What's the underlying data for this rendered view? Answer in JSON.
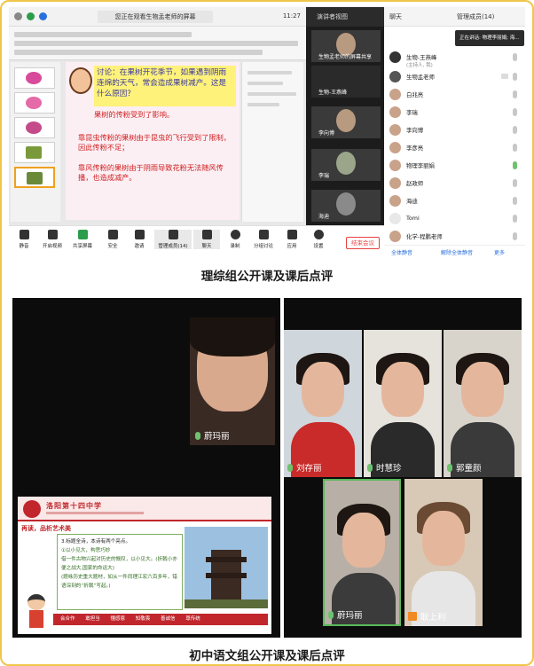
{
  "top": {
    "window_title": "您正在观看生物孟老师的屏幕",
    "time": "11:27",
    "slide": {
      "question": "讨论：在果树开花季节，如果遇到阴雨连绵的天气，常会造成果树减产。这是什么原因？",
      "answer1": "果树的传粉受到了影响。",
      "answer2": "靠昆虫传粉的果树由于昆虫的飞行受到了限制，因此传粉不足；",
      "answer3": "靠风传粉的果树由于阴雨导致花粉无法随风传播，也造成减产。"
    },
    "video_column": {
      "header": "演讲者视图",
      "tiles": [
        {
          "name": "生物孟老师的屏幕共享"
        },
        {
          "name": "生物-王燕峰"
        },
        {
          "name": "李向博"
        },
        {
          "name": "李瑞"
        },
        {
          "name": "海迪"
        }
      ]
    },
    "panel": {
      "tab_chat": "聊天",
      "tab_participants": "管理成员(14)",
      "speaking": "正在讲话: 物理李丽娟; 海...",
      "participants": [
        {
          "name": "生物-王燕峰",
          "sub": "(主持人, 我)"
        },
        {
          "name": "生物孟老师"
        },
        {
          "name": "白兆亮"
        },
        {
          "name": "李瑞"
        },
        {
          "name": "李向博"
        },
        {
          "name": "李彦亮"
        },
        {
          "name": "物理李丽娟"
        },
        {
          "name": "赵政师"
        },
        {
          "name": "海迪"
        },
        {
          "name": "Tomi"
        },
        {
          "name": "化学-程鹏老师"
        }
      ],
      "buttons": {
        "mute_all": "全体静音",
        "unmute_all": "解除全体静音",
        "more": "更多"
      }
    },
    "toolbar": {
      "items": [
        "静音",
        "开启视频",
        "共享屏幕",
        "安全",
        "邀请",
        "管理成员(14)",
        "聊天",
        "录制",
        "分组讨论",
        "应用",
        "设置"
      ],
      "leave": "结束会议"
    }
  },
  "captions": {
    "top": "理综组公开课及课后点评",
    "bottom": "初中语文组公开课及课后点评"
  },
  "bottom_left": {
    "teacher": "蔚玛丽",
    "ppt": {
      "school": "洛阳第十四中学",
      "section": "再读，品析艺术美",
      "line1": "3.标题全诗，本诗有两个亮点。",
      "line2": "①以小见大，构思巧妙",
      "line3": "借一件古物兴起对历史的慨叹，以小见大。(折戟小亦便之战大,国家的命运大)",
      "line4": "(题咏历史重大题材，如从一件同理江宏六百多年，错语深刻的“折戟”写起。)",
      "footer": "会合作 敢担当 懂感恩 知敬畏 善诚信 尊传统"
    }
  },
  "bottom_right": {
    "tiles": [
      {
        "name": "刘存丽"
      },
      {
        "name": "时慧珍"
      },
      {
        "name": "郭童颜"
      },
      {
        "name": "蔚玛丽"
      },
      {
        "name": "耿上利"
      }
    ]
  }
}
